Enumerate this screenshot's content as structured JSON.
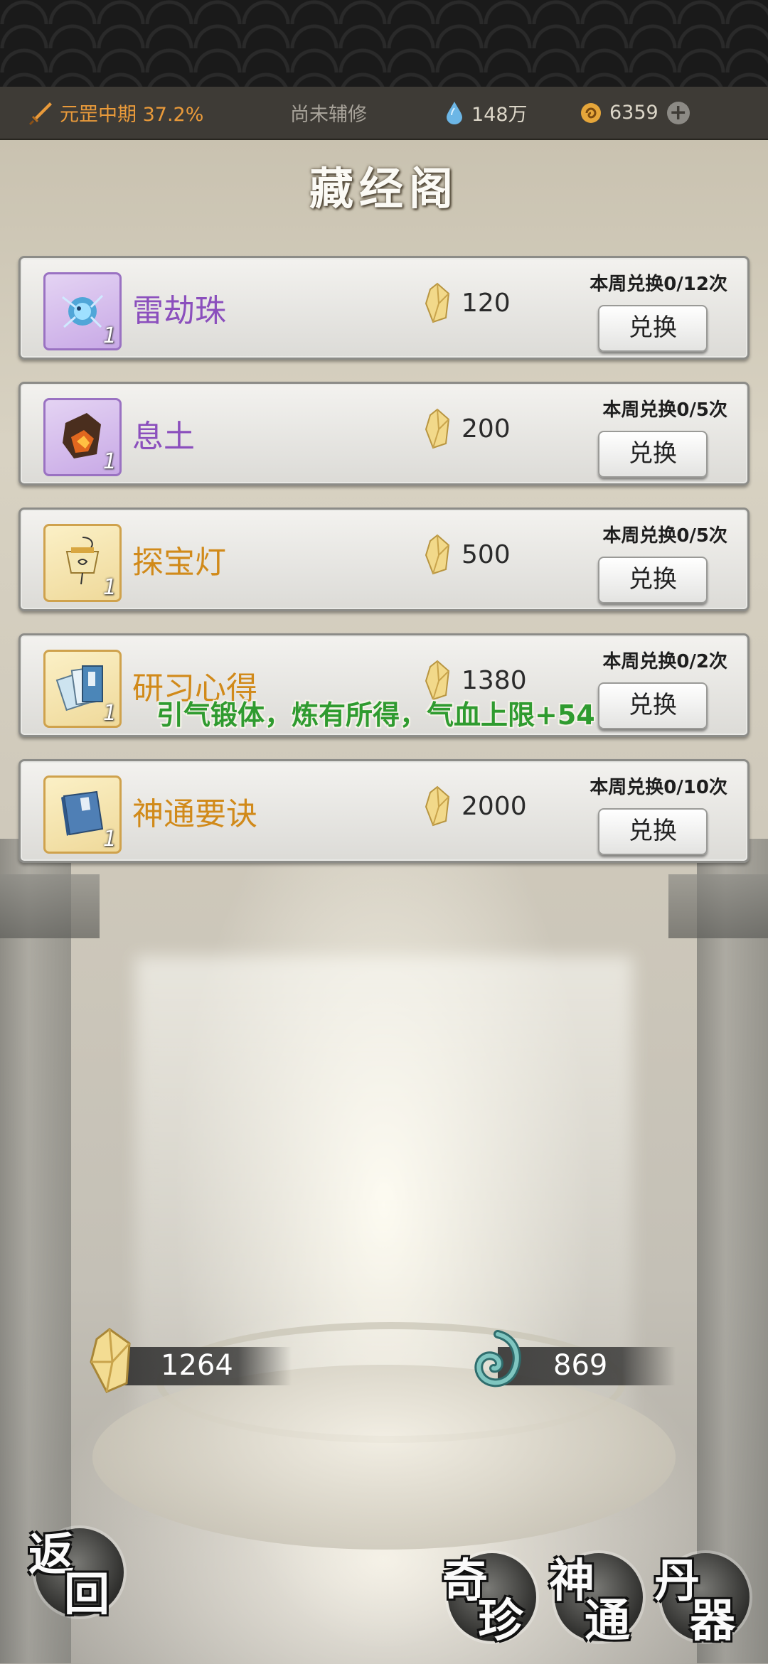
{
  "status_bar": {
    "realm": "元罡中期 37.2%",
    "assist": "尚未辅修",
    "spirit_stones": "148万",
    "coins": "6359",
    "plus": "+"
  },
  "title": "藏经阁",
  "items": [
    {
      "name": "雷劫珠",
      "qty": "1",
      "price": "120",
      "limit": "本周兑换0/12次",
      "button": "兑换",
      "rarity": "purple"
    },
    {
      "name": "息土",
      "qty": "1",
      "price": "200",
      "limit": "本周兑换0/5次",
      "button": "兑换",
      "rarity": "purple"
    },
    {
      "name": "探宝灯",
      "qty": "1",
      "price": "500",
      "limit": "本周兑换0/5次",
      "button": "兑换",
      "rarity": "gold"
    },
    {
      "name": "研习心得",
      "qty": "1",
      "price": "1380",
      "limit": "本周兑换0/2次",
      "button": "兑换",
      "rarity": "gold"
    },
    {
      "name": "神通要诀",
      "qty": "1",
      "price": "2000",
      "limit": "本周兑换0/10次",
      "button": "兑换",
      "rarity": "gold"
    }
  ],
  "float_tip": "引气锻体，炼有所得，气血上限+54",
  "currency": {
    "crystal": "1264",
    "spirit": "869"
  },
  "nav": {
    "back": [
      "返",
      "回"
    ],
    "treasure": [
      "奇",
      "珍"
    ],
    "skill": [
      "神",
      "通"
    ],
    "elixir": [
      "丹",
      "器"
    ]
  },
  "colors": {
    "purple": "#8b4fbd",
    "gold": "#d18a1a",
    "tip_green": "#2f9b2f",
    "realm_orange": "#e99a3a"
  }
}
